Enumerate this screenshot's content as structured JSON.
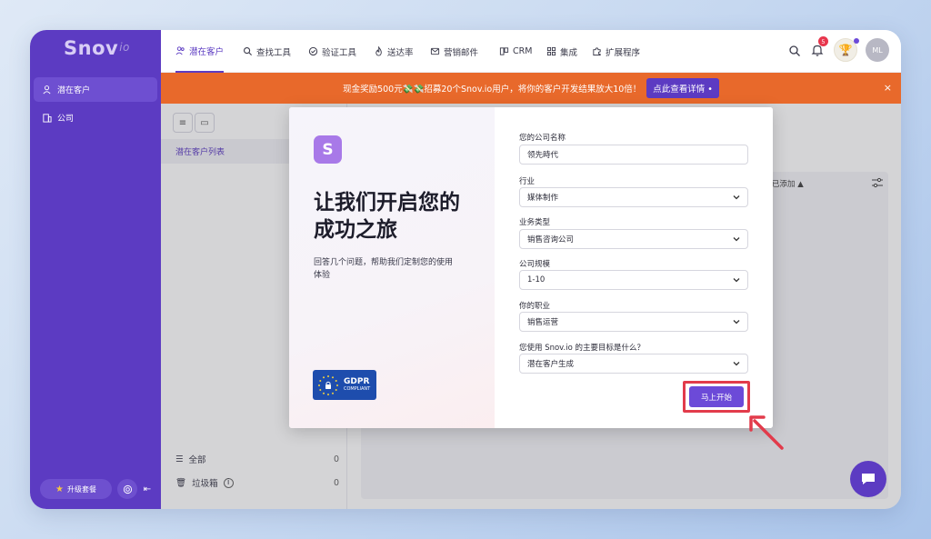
{
  "logo": {
    "main": "Snov",
    "suffix": "io"
  },
  "sidebar": {
    "items": [
      {
        "label": "潜在客户",
        "icon": "person-icon"
      },
      {
        "label": "公司",
        "icon": "building-icon"
      }
    ],
    "upgrade_label": "升级套餐"
  },
  "topnav": {
    "items": [
      {
        "label": "潜在客户",
        "icon": "people-icon"
      },
      {
        "label": "查找工具",
        "icon": "search-icon"
      },
      {
        "label": "验证工具",
        "icon": "check-circle-icon"
      },
      {
        "label": "送达率",
        "icon": "flame-icon"
      },
      {
        "label": "营销邮件",
        "icon": "mail-icon"
      },
      {
        "label": "CRM",
        "icon": "crm-icon"
      },
      {
        "label": "集成",
        "icon": "grid-icon"
      },
      {
        "label": "扩展程序",
        "icon": "puzzle-icon"
      }
    ],
    "notification_count": "5",
    "avatar_initials": "ML"
  },
  "banner": {
    "text": "现金奖励500元💸💸招募20个Snov.io用户，将你的客户开发结果放大10倍！",
    "link_label": "点此查看详情 •",
    "close": "×"
  },
  "left_panel": {
    "list_tab": "潜在客户列表",
    "all_label": "全部",
    "all_count": "0",
    "trash_label": "垃圾箱",
    "trash_count": "0"
  },
  "table": {
    "column_head": "已添加 ▲"
  },
  "modal": {
    "logo_letter": "S",
    "title": "让我们开启您的成功之旅",
    "subtitle": "回答几个问题，帮助我们定制您的使用体验",
    "gdpr": {
      "line1": "GDPR",
      "line2": "COMPLIANT"
    },
    "fields": [
      {
        "label": "您的公司名称",
        "value": "领先時代",
        "type": "text"
      },
      {
        "label": "行业",
        "value": "媒体制作",
        "type": "select"
      },
      {
        "label": "业务类型",
        "value": "销售咨询公司",
        "type": "select"
      },
      {
        "label": "公司规模",
        "value": "1-10",
        "type": "select"
      },
      {
        "label": "你的职业",
        "value": "销售运营",
        "type": "select"
      },
      {
        "label": "您使用 Snov.io 的主要目标是什么？",
        "value": "潜在客户生成",
        "type": "select"
      }
    ],
    "start_label": "马上开始"
  },
  "colors": {
    "sidebar": "#5c3bc2",
    "banner": "#e8692b",
    "accent": "#6c4ad8",
    "highlight": "#e23b4b"
  }
}
